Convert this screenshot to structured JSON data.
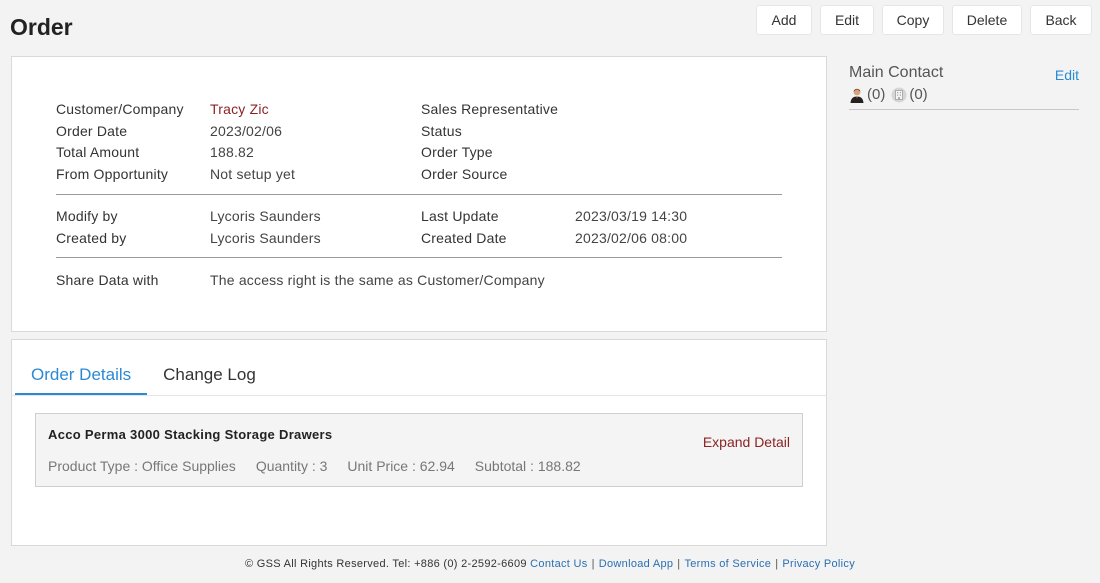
{
  "page": {
    "title": "Order"
  },
  "toolbar": {
    "add_label": "Add",
    "edit_label": "Edit",
    "copy_label": "Copy",
    "delete_label": "Delete",
    "back_label": "Back"
  },
  "info": {
    "customer_label": "Customer/Company",
    "customer_value": "Tracy Zic",
    "order_date_label": "Order Date",
    "order_date_value": "2023/02/06",
    "total_label": "Total Amount",
    "total_value": "188.82",
    "opportunity_label": "From Opportunity",
    "opportunity_value": "Not setup yet",
    "sales_rep_label": "Sales Representative",
    "status_label": "Status",
    "order_type_label": "Order Type",
    "order_source_label": "Order Source",
    "modify_by_label": "Modify by",
    "modify_by_value": "Lycoris Saunders",
    "created_by_label": "Created by",
    "created_by_value": "Lycoris Saunders",
    "last_update_label": "Last Update",
    "last_update_value": "2023/03/19 14:30",
    "created_date_label": "Created Date",
    "created_date_value": "2023/02/06 08:00",
    "share_label": "Share Data with",
    "share_value": "The access right is the same as Customer/Company"
  },
  "side": {
    "title": "Main Contact",
    "edit_label": "Edit",
    "person_count": "(0)",
    "company_count": "(0)"
  },
  "tabs": [
    {
      "label": "Order Details"
    },
    {
      "label": "Change Log"
    }
  ],
  "item": {
    "name": "Acco Perma 3000 Stacking Storage Drawers",
    "expand_label": "Expand Detail",
    "product_type": "Product Type : Office Supplies",
    "quantity": "Quantity : 3",
    "unit_price": "Unit Price : 62.94",
    "subtotal": "Subtotal : 188.82"
  },
  "footer": {
    "copyright": "© GSS All Rights Reserved. Tel: +886 (0) 2-2592-6609",
    "contact_us": "Contact Us",
    "download_app": "Download App",
    "terms": "Terms of Service",
    "privacy": "Privacy Policy",
    "separator": "|"
  },
  "colors": {
    "accent": "#2a8ad4",
    "link_red": "#8b2323",
    "background": "#f3f3f3"
  }
}
